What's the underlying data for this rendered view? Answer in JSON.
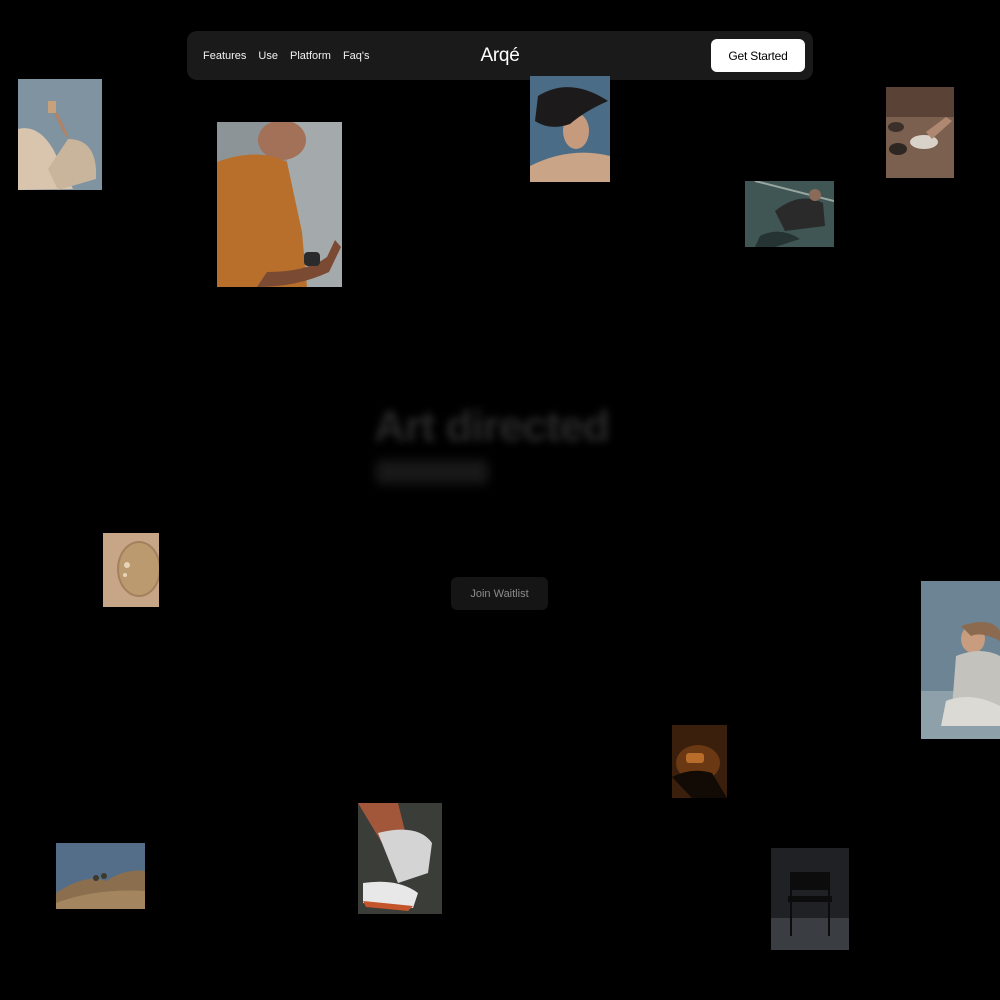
{
  "nav": {
    "links": [
      "Features",
      "Use",
      "Platform",
      "Faq's"
    ],
    "brand": "Arqé",
    "cta_label": "Get Started"
  },
  "hero": {
    "headline": "Art directed",
    "waitlist_label": "Join Waitlist"
  },
  "colors": {
    "background": "#000000",
    "nav_bg": "#1a1a1a",
    "cta_bg": "#ffffff",
    "waitlist_bg": "#151515"
  }
}
